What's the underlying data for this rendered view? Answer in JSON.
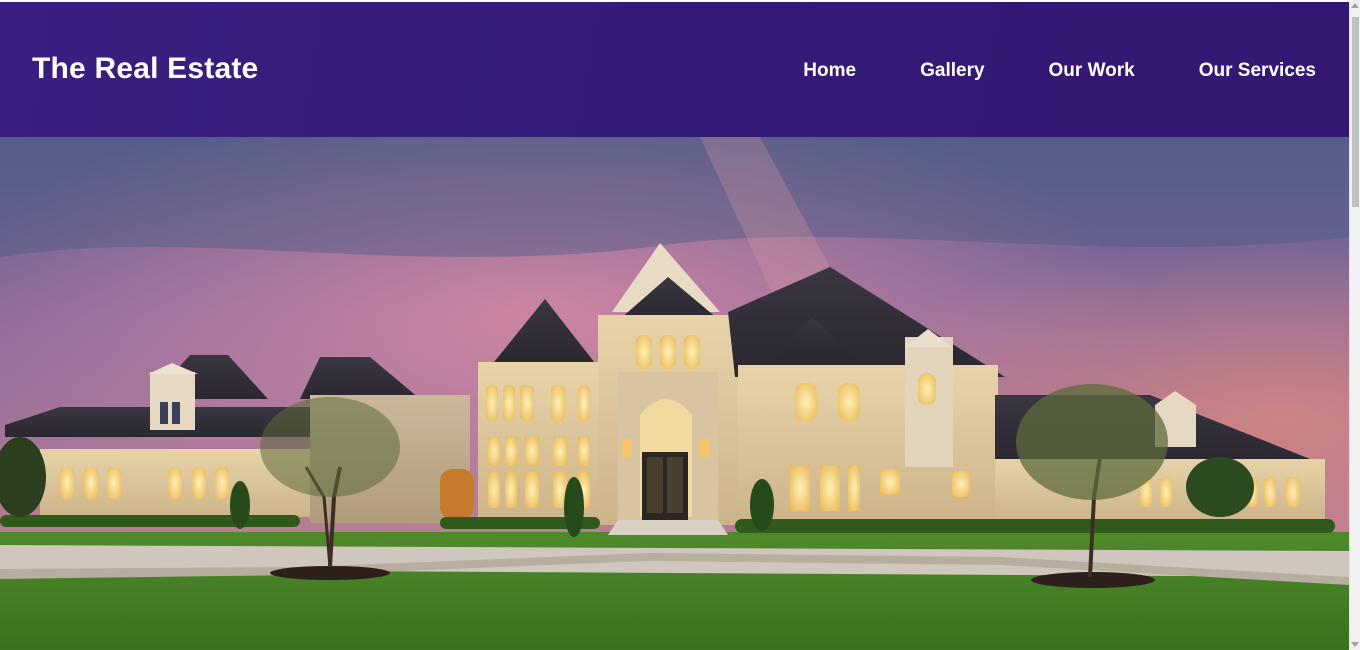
{
  "navbar": {
    "brand": "The Real Estate",
    "links": [
      {
        "label": "Home"
      },
      {
        "label": "Gallery"
      },
      {
        "label": "Our Work"
      },
      {
        "label": "Our Services"
      }
    ]
  },
  "hero": {
    "image_subject": "luxury-mansion-at-dusk"
  },
  "colors": {
    "navbar_bg": "#361a78",
    "nav_text": "#ffffff"
  }
}
